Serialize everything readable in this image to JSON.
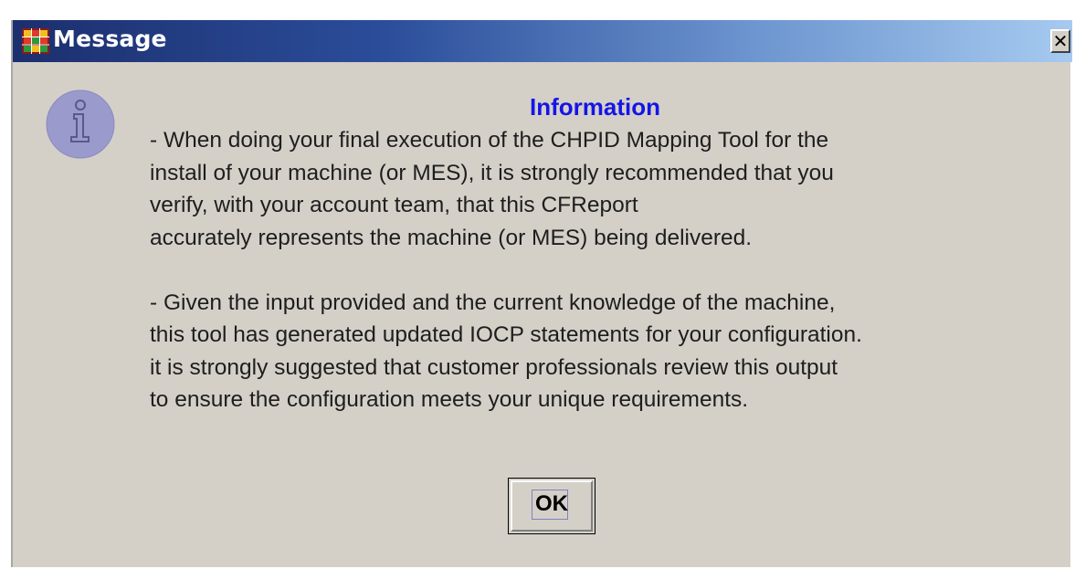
{
  "window": {
    "title": "Message",
    "close_label": "✕"
  },
  "dialog": {
    "heading": "Information",
    "paragraphs": [
      [
        "- When doing your final execution of the CHPID Mapping Tool for the",
        "install of your machine (or MES), it is strongly recommended that you",
        "verify, with your account team, that this CFReport",
        "accurately represents the machine (or MES) being delivered."
      ],
      [
        "- Given the input provided and the current knowledge of the machine,",
        "this tool has generated updated IOCP statements for your configuration.",
        "it is strongly suggested that customer professionals review this output",
        "to ensure the configuration meets your unique requirements."
      ]
    ],
    "ok_label": "OK"
  },
  "icons": {
    "app": "app-grid-icon",
    "info": "info-icon",
    "close": "close-icon"
  },
  "colors": {
    "heading": "#1515e6",
    "titlebar_start": "#1c2f6e",
    "titlebar_end": "#a6caf0",
    "dialog_bg": "#d4d0c8",
    "info_icon": "#9a9acc"
  }
}
